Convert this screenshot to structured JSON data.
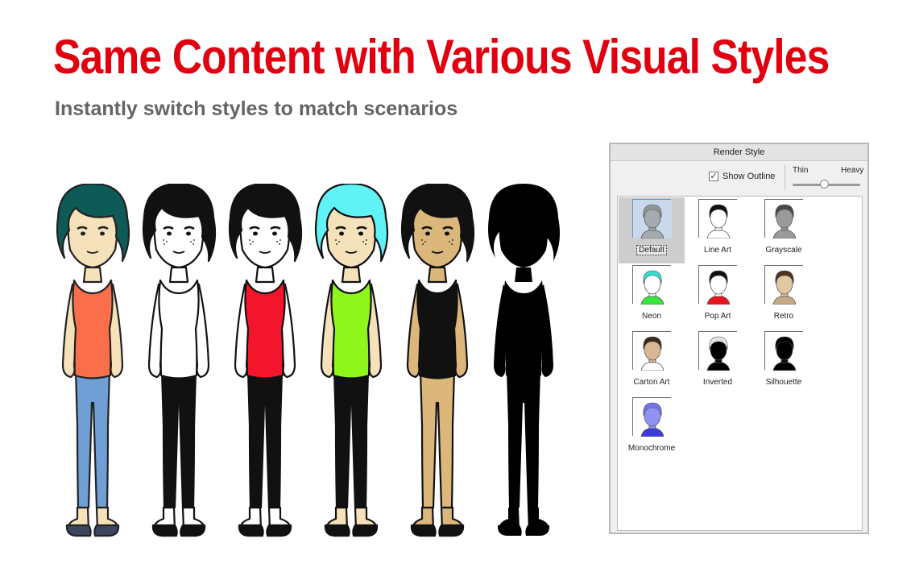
{
  "headline": "Same Content with Various Visual Styles",
  "subheadline": "Instantly switch styles to match scenarios",
  "colors": {
    "headline": "#e0000f",
    "subheadline": "#646464",
    "selection": "#cdcdcd"
  },
  "figures": [
    {
      "hair": "#0d5a57",
      "skin": "#f6e2ba",
      "top": "#fa6e4a",
      "pants": "#6f9fd4",
      "shoes": "#3a4660",
      "line": "#222222",
      "freckles": false
    },
    {
      "hair": "#111111",
      "skin": "#ffffff",
      "top": "#ffffff",
      "pants": "#111111",
      "shoes": "#111111",
      "line": "#111111",
      "freckles": true
    },
    {
      "hair": "#111111",
      "skin": "#ffffff",
      "top": "#f3152b",
      "pants": "#111111",
      "shoes": "#111111",
      "line": "#111111",
      "freckles": true
    },
    {
      "hair": "#5ff3f6",
      "skin": "#f6e2ba",
      "top": "#8ef61a",
      "pants": "#111111",
      "shoes": "#111111",
      "line": "#111111",
      "freckles": true
    },
    {
      "hair": "#111111",
      "skin": "#dcb77c",
      "top": "#111111",
      "pants": "#dcb77c",
      "shoes": "#111111",
      "line": "#111111",
      "freckles": true
    },
    {
      "hair": "#000000",
      "skin": "#000000",
      "top": "#000000",
      "pants": "#000000",
      "shoes": "#000000",
      "line": "#000000",
      "freckles": false,
      "silhouette": true
    }
  ],
  "panel": {
    "title": "Render Style",
    "show_outline_label": "Show Outline",
    "show_outline_checked": true,
    "thin_label": "Thin",
    "heavy_label": "Heavy",
    "outline_weight_fraction": 0.48,
    "selected_style": "Default",
    "styles": [
      {
        "label": "Default",
        "icon": "default-style-icon",
        "bg": "#c9d8ea",
        "hair": "#8f979d",
        "face": "#a5abae",
        "shirt": "#a5abae"
      },
      {
        "label": "Line Art",
        "icon": "line-art-style-icon",
        "bg": "#ffffff",
        "hair": "#111111",
        "face": "#ffffff",
        "shirt": "#ffffff"
      },
      {
        "label": "Grayscale",
        "icon": "grayscale-style-icon",
        "bg": "#ffffff",
        "hair": "#4a4a4a",
        "face": "#9a9a9a",
        "shirt": "#9a9a9a"
      },
      {
        "label": "Neon",
        "icon": "neon-style-icon",
        "bg": "#ffffff",
        "hair": "#38d8cf",
        "face": "#ffffff",
        "shirt": "#39e53a"
      },
      {
        "label": "Pop Art",
        "icon": "pop-art-style-icon",
        "bg": "#ffffff",
        "hair": "#111111",
        "face": "#ffffff",
        "shirt": "#e8131c"
      },
      {
        "label": "Retro",
        "icon": "retro-style-icon",
        "bg": "#ffffff",
        "hair": "#4c3421",
        "face": "#e1c6a2",
        "shirt": "#c8ab84"
      },
      {
        "label": "Carton Art",
        "icon": "cartoon-art-style-icon",
        "bg": "#ffffff",
        "hair": "#3a2a1a",
        "face": "#dab896",
        "shirt": "#ffffff"
      },
      {
        "label": "Inverted",
        "icon": "inverted-style-icon",
        "bg": "#ffffff",
        "hair": "#e2e2e2",
        "face": "#000000",
        "shirt": "#000000"
      },
      {
        "label": "Silhouette",
        "icon": "silhouette-style-icon",
        "bg": "#ffffff",
        "hair": "#000000",
        "face": "#000000",
        "shirt": "#000000"
      },
      {
        "label": "Monochrome",
        "icon": "monochrome-style-icon",
        "bg": "#ffffff",
        "hair": "#7072ee",
        "face": "#8f92f3",
        "shirt": "#3a3ae0"
      }
    ]
  }
}
